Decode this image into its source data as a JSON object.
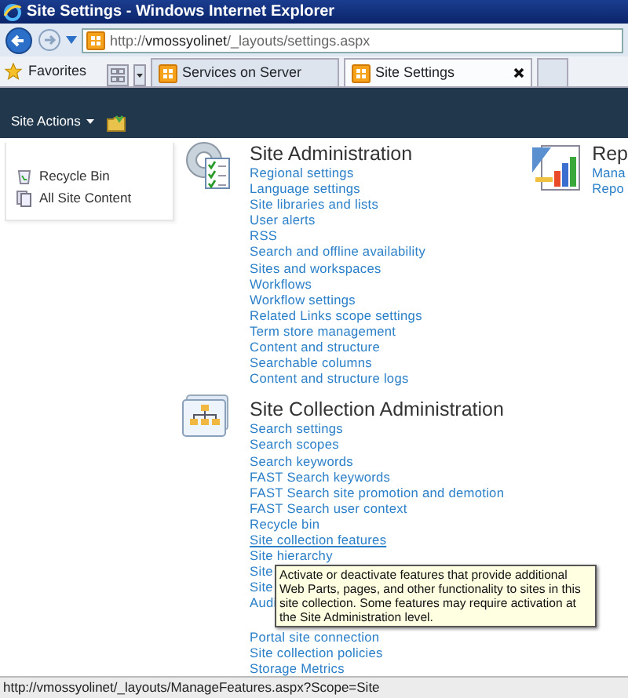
{
  "window": {
    "title": "Site Settings - Windows Internet Explorer"
  },
  "address_bar": {
    "url": "http://**vmossyolinet**/_layouts/settings.aspx"
  },
  "favorites": {
    "label": "Favorites"
  },
  "tabs": [
    {
      "label": "Services on Server",
      "selected": false
    },
    {
      "label": "Site Settings",
      "selected": true
    }
  ],
  "ribbon": {
    "site_actions": "Site Actions"
  },
  "quick_launch": [
    {
      "label": "Recycle Bin",
      "kind": "bin"
    },
    {
      "label": "All Site Content",
      "kind": "content"
    }
  ],
  "sections": [
    {
      "title": "Site Administration",
      "kind": "admin",
      "links": [
        {
          "label": "Regional settings",
          "hovered": false
        },
        {
          "label": "Language settings",
          "hovered": false
        },
        {
          "label": "Site libraries and lists",
          "hovered": false
        },
        {
          "label": "User alerts",
          "hovered": false
        },
        {
          "label": "RSS",
          "hovered": false
        },
        {
          "label": "Search and offline availability",
          "hovered": false
        },
        {
          "label": "Sites and workspaces",
          "hovered": false
        },
        {
          "label": "Workflows",
          "hovered": false
        },
        {
          "label": "Workflow settings",
          "hovered": false
        },
        {
          "label": "Related Links scope settings",
          "hovered": false
        },
        {
          "label": "Term store management",
          "hovered": false
        },
        {
          "label": "Content and structure",
          "hovered": false
        },
        {
          "label": "Searchable columns",
          "hovered": false
        },
        {
          "label": "Content and structure logs",
          "hovered": false
        }
      ]
    },
    {
      "title": "Site Collection Administration",
      "kind": "collection",
      "links": [
        {
          "label": "Search settings",
          "hovered": false
        },
        {
          "label": "Search scopes",
          "hovered": false
        },
        {
          "label": "Search keywords",
          "hovered": false
        },
        {
          "label": "FAST Search keywords",
          "hovered": false
        },
        {
          "label": "FAST Search site promotion and demotion",
          "hovered": false
        },
        {
          "label": "FAST Search user context",
          "hovered": false
        },
        {
          "label": "Recycle bin",
          "hovered": false
        },
        {
          "label": "Site collection features",
          "hovered": true
        },
        {
          "label": "Site hierarchy",
          "hovered": false
        },
        {
          "label": "Site",
          "hovered": false
        },
        {
          "label": "Site",
          "hovered": false
        },
        {
          "label": "Audi",
          "hovered": false
        },
        {
          "label": "Portal site connection",
          "hovered": false
        },
        {
          "label": "Site collection policies",
          "hovered": false
        },
        {
          "label": "Storage Metrics",
          "hovered": false
        }
      ]
    }
  ],
  "side_section": {
    "title": "Rep",
    "links": [
      "Mana",
      "Repo"
    ]
  },
  "tooltip": {
    "text": "Activate or deactivate features that provide additional Web Parts, pages, and other functionality to sites in this site collection. Some features may require activation at the Site Administration level."
  },
  "status_bar": {
    "text": "http://vmossyolinet/_layouts/ManageFeatures.aspx?Scope=Site"
  }
}
